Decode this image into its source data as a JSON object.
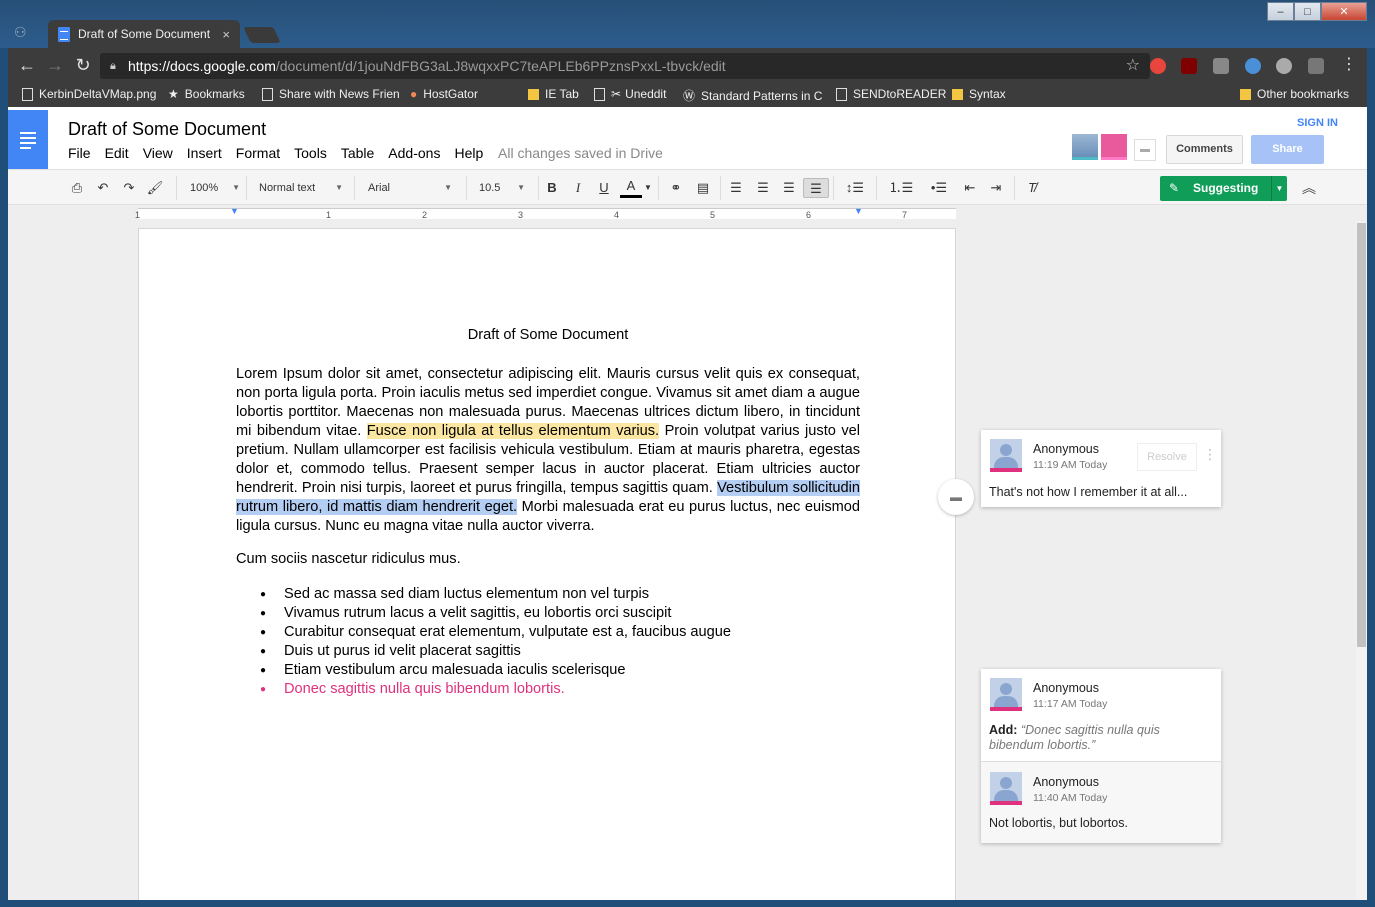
{
  "browser": {
    "tab_title": "Draft of Some Document",
    "tab_close": "×",
    "url_host": "https://docs.google.com",
    "url_path": "/document/d/1jouNdFBG3aLJ8wqxxPC7teAPLEb6PPznsPxxL-tbvck/edit",
    "window_controls": {
      "minimize": "–",
      "maximize": "□",
      "close": "✕"
    },
    "bookmarks": [
      {
        "label": "KerbinDeltaVMap.png",
        "icon": "page-icon"
      },
      {
        "label": "Bookmarks",
        "icon": "star-icon"
      },
      {
        "label": "Share with News Frien",
        "icon": "page-icon"
      },
      {
        "label": "HostGator",
        "icon": "hostgator-icon"
      },
      {
        "label": "IE Tab",
        "icon": "folder-icon"
      },
      {
        "label": "Uneddit",
        "icon": "scissors-icon"
      },
      {
        "label": "Standard Patterns in C",
        "icon": "wordpress-icon"
      },
      {
        "label": "SENDtoREADER",
        "icon": "page-icon"
      },
      {
        "label": "Syntax",
        "icon": "folder-icon"
      },
      {
        "label": "Other bookmarks",
        "icon": "folder-icon"
      }
    ]
  },
  "docs": {
    "title": "Draft of Some Document",
    "menu": [
      "File",
      "Edit",
      "View",
      "Insert",
      "Format",
      "Tools",
      "Table",
      "Add-ons",
      "Help"
    ],
    "save_status": "All changes saved in Drive",
    "sign_in": "SIGN IN",
    "comments_label": "Comments",
    "share_label": "Share",
    "toolbar": {
      "zoom": "100%",
      "style": "Normal text",
      "font": "Arial",
      "size": "10.5",
      "mode": "Suggesting"
    },
    "ruler_numbers": [
      "1",
      "1",
      "2",
      "3",
      "4",
      "5",
      "6",
      "7"
    ]
  },
  "document": {
    "heading": "Draft of Some Document",
    "para1_a": "Lorem Ipsum dolor sit amet, consectetur adipiscing elit. Mauris cursus velit quis ex consequat, non porta ligula porta. Proin iaculis metus sed imperdiet congue. Vivamus sit amet diam a augue lobortis porttitor. Maecenas non malesuada purus. Maecenas ultrices dictum libero, in tincidunt mi bibendum vitae. ",
    "para1_hl_yellow": "Fusce non ligula at tellus elementum varius.",
    "para1_b": " Proin volutpat varius justo vel pretium. Nullam ullamcorper est facilisis vehicula vestibulum. Etiam at mauris pharetra, egestas dolor et, commodo tellus. Praesent semper lacus in auctor placerat. Etiam ultricies auctor hendrerit. Proin nisi turpis, laoreet et purus fringilla, tempus sagittis quam. ",
    "para1_hl_blue": "Vestibulum sollicitudin rutrum libero, id mattis diam hendrerit eget.",
    "para1_c": " Morbi malesuada erat eu purus luctus, nec euismod ligula cursus. Nunc eu magna vitae nulla auctor viverra.",
    "para2": "Cum sociis nascetur ridiculus mus.",
    "bullets": [
      "Sed ac massa sed diam luctus elementum non vel turpis",
      "Vivamus rutrum lacus a velit sagittis, eu lobortis orci suscipit",
      "Curabitur consequat erat elementum, vulputate est a, faucibus augue",
      "Duis ut purus id velit placerat sagittis",
      "Etiam vestibulum arcu malesuada iaculis scelerisque",
      "Donec sagittis nulla quis bibendum lobortis."
    ]
  },
  "comments": {
    "card1": {
      "author": "Anonymous",
      "time": "11:19 AM Today",
      "resolve": "Resolve",
      "body": "That's not how I remember it at all..."
    },
    "card2": {
      "author": "Anonymous",
      "time": "11:17 AM Today",
      "add_label": "Add:",
      "add_quote": "“Donec sagittis nulla quis bibendum lobortis.”",
      "reply_author": "Anonymous",
      "reply_time": "11:40 AM Today",
      "reply_body": "Not lobortis, but lobortos."
    }
  },
  "colors": {
    "docs_blue": "#4285f4",
    "suggest_green": "#0f9d58",
    "suggestion_pink": "#e0317e",
    "highlight_yellow": "#fbe6a2",
    "highlight_blue": "#b3cdf3"
  }
}
